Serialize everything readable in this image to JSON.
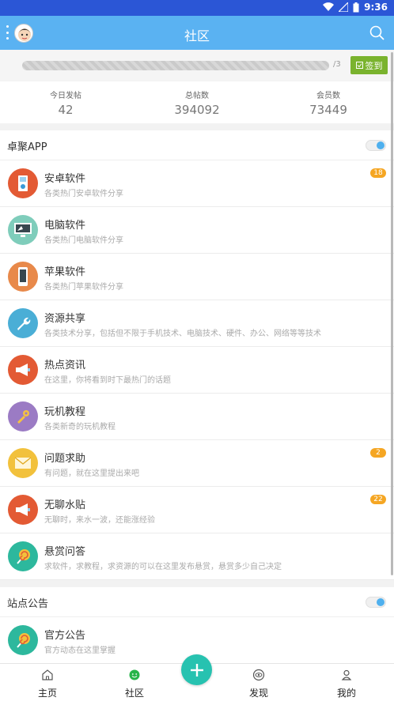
{
  "status": {
    "time": "9:36"
  },
  "header": {
    "title": "社区"
  },
  "signin": {
    "count": "/3",
    "button": "签到"
  },
  "stats": [
    {
      "label": "今日发帖",
      "value": "42"
    },
    {
      "label": "总帖数",
      "value": "394092"
    },
    {
      "label": "会员数",
      "value": "73449"
    }
  ],
  "section_app": {
    "name": "卓聚APP"
  },
  "forums": [
    {
      "title": "安卓软件",
      "desc": "各类热门安卓软件分享",
      "badge": "18",
      "icon": "android-phone-icon",
      "color": "#e35a34"
    },
    {
      "title": "电脑软件",
      "desc": "各类热门电脑软件分享",
      "badge": "",
      "icon": "monitor-icon",
      "color": "#3fb39b"
    },
    {
      "title": "苹果软件",
      "desc": "各类热门苹果软件分享",
      "badge": "",
      "icon": "iphone-icon",
      "color": "#e8894a"
    },
    {
      "title": "资源共享",
      "desc": "各类技术分享，包括但不限于手机技术、电脑技术、硬件、办公、网络等等技术",
      "badge": "",
      "icon": "wrench-icon",
      "color": "#4aaed6"
    },
    {
      "title": "热点资讯",
      "desc": "在这里，你将看到时下最热门的话题",
      "badge": "",
      "icon": "megaphone-icon",
      "color": "#e35a34"
    },
    {
      "title": "玩机教程",
      "desc": "各类新奇的玩机教程",
      "badge": "",
      "icon": "tools-icon",
      "color": "#9b7bc4"
    },
    {
      "title": "问题求助",
      "desc": "有问题，就在这里提出来吧",
      "badge": "2",
      "icon": "envelope-icon",
      "color": "#f2c13c"
    },
    {
      "title": "无聊水贴",
      "desc": "无聊时，来水一波，还能涨经验",
      "badge": "22",
      "icon": "megaphone-icon",
      "color": "#e35a34"
    },
    {
      "title": "悬赏问答",
      "desc": "求软件，求教程，求资源的可以在这里发布悬赏，悬赏多少自己决定",
      "badge": "",
      "icon": "lollipop-icon",
      "color": "#2db89d"
    }
  ],
  "section_notice": {
    "name": "站点公告"
  },
  "notice": {
    "title": "官方公告",
    "desc": "官方动态在这里掌握",
    "icon": "lollipop-icon",
    "color": "#2db89d"
  },
  "nav": [
    {
      "label": "主页",
      "icon": "home-icon"
    },
    {
      "label": "社区",
      "icon": "community-icon"
    },
    {
      "label": "发现",
      "icon": "eye-icon"
    },
    {
      "label": "我的",
      "icon": "user-icon"
    }
  ]
}
